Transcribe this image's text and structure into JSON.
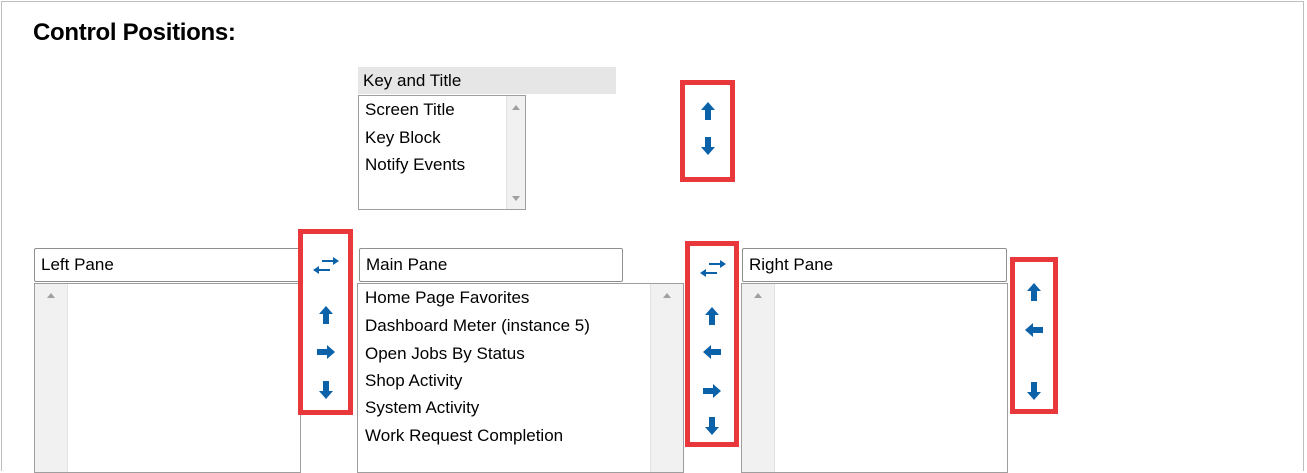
{
  "page": {
    "title": "Control Positions:"
  },
  "key_title": {
    "header": "Key and Title",
    "items": [
      "Screen Title",
      "Key Block",
      "Notify Events"
    ]
  },
  "left_pane": {
    "label": "Left Pane",
    "items": []
  },
  "main_pane": {
    "label": "Main Pane",
    "items": [
      "Home Page Favorites",
      "Dashboard Meter (instance 5)",
      "Open Jobs By Status",
      "Shop Activity",
      "System Activity",
      "Work Request Completion"
    ]
  },
  "right_pane": {
    "label": "Right Pane",
    "items": []
  },
  "icons": {
    "accent": "#0b62a9",
    "highlight_border": "#e8383c",
    "key_title_buttons": [
      "move-up-icon",
      "move-down-icon"
    ],
    "left_buttons": [
      "swap-icon",
      "move-up-icon",
      "move-right-icon",
      "move-down-icon"
    ],
    "main_buttons": [
      "swap-icon",
      "move-up-icon",
      "move-left-icon",
      "move-right-icon",
      "move-down-icon"
    ],
    "right_buttons": [
      "move-up-icon",
      "move-left-icon",
      "move-down-icon"
    ]
  }
}
